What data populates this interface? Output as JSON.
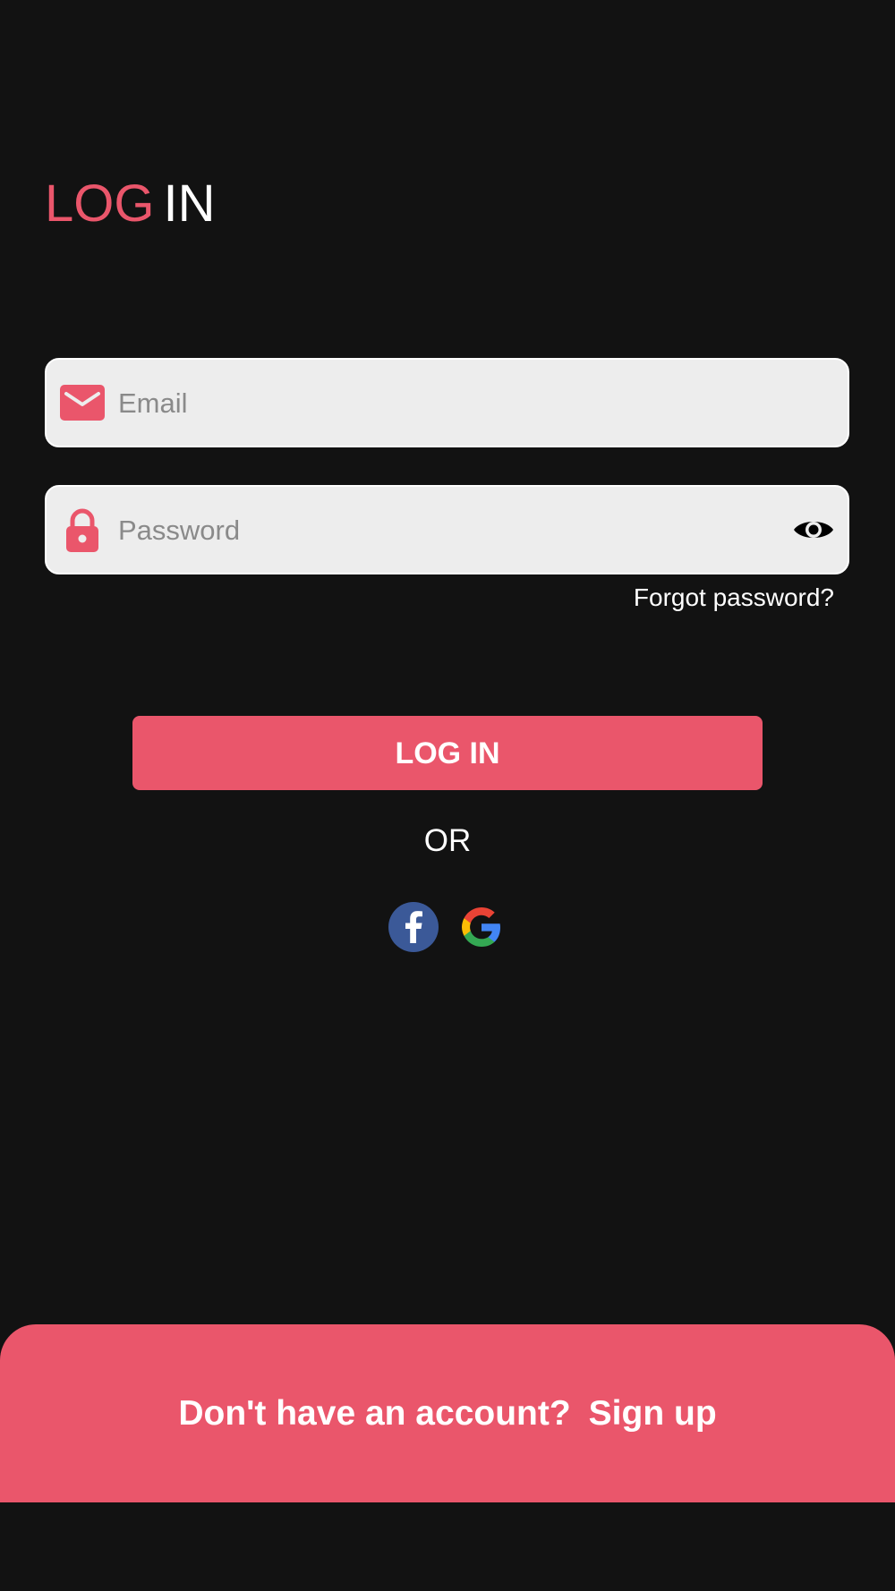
{
  "header": {
    "title_part1": "LOG",
    "title_part2": "IN"
  },
  "form": {
    "email_placeholder": "Email",
    "email_value": "",
    "password_placeholder": "Password",
    "password_value": "",
    "forgot_password": "Forgot password?",
    "login_button": "LOG IN",
    "or_label": "OR"
  },
  "icons": {
    "email": "envelope-icon",
    "password": "lock-icon",
    "toggle_visibility": "eye-icon",
    "facebook": "facebook-icon",
    "google": "google-icon"
  },
  "footer": {
    "question": "Don't have an account?",
    "signup": "Sign up"
  },
  "colors": {
    "background": "#121212",
    "accent": "#EA566B",
    "field_background": "#EDEDED",
    "text_light": "#FFFFFF",
    "facebook_blue": "#3B5998"
  }
}
